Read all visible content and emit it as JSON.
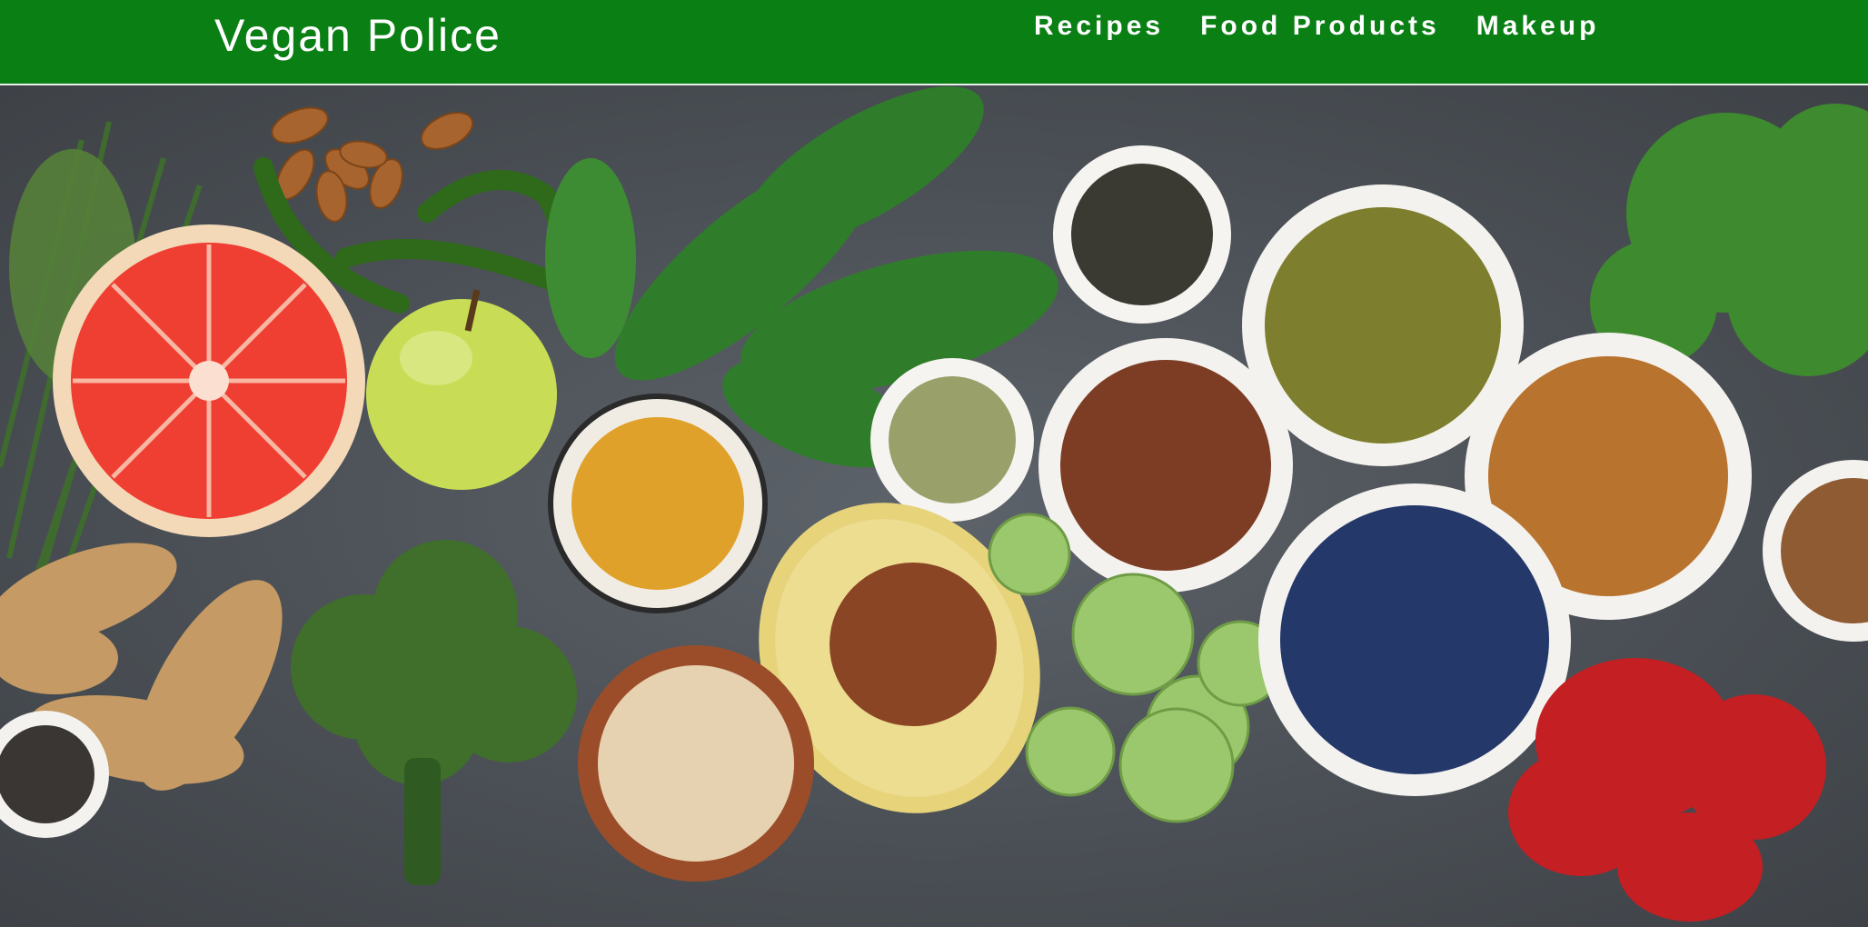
{
  "nav": {
    "brand": "Vegan Police",
    "links": [
      {
        "label": "Recipes"
      },
      {
        "label": "Food Products"
      },
      {
        "label": "Makeup"
      }
    ]
  },
  "hero": {
    "icon": "vegetables-flatlay-image",
    "colors": {
      "navbar": "#0a7f14",
      "background": "#4b5056"
    }
  }
}
